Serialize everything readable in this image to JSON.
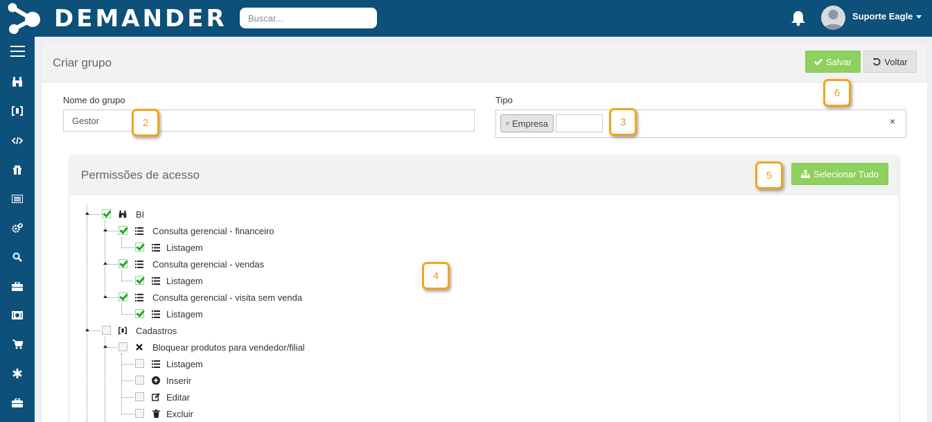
{
  "app": {
    "brand": "DEMANDER",
    "search_placeholder": "Buscar...",
    "user_name": "Suporte Eagle",
    "colors": {
      "topbar": "#0d5079",
      "success": "#8fd05f",
      "callout": "#f5a31a"
    }
  },
  "sidebar": {
    "items": [
      {
        "icon": "menu-icon"
      },
      {
        "icon": "binoculars-icon"
      },
      {
        "icon": "bracket-icon"
      },
      {
        "icon": "code-icon"
      },
      {
        "icon": "gift-icon"
      },
      {
        "icon": "list-card-icon"
      },
      {
        "icon": "gears-icon"
      },
      {
        "icon": "search-icon"
      },
      {
        "icon": "briefcase-icon"
      },
      {
        "icon": "money-icon"
      },
      {
        "icon": "cart-icon"
      },
      {
        "icon": "asterisk-icon"
      },
      {
        "icon": "briefcase-icon"
      }
    ]
  },
  "page": {
    "title": "Criar grupo",
    "save_label": "Salvar",
    "back_label": "Voltar",
    "name_label": "Nome do grupo",
    "name_value": "Gestor",
    "type_label": "Tipo",
    "type_tag": "Empresa",
    "tag_remove": "×",
    "clear": "×"
  },
  "permissions": {
    "title": "Permissões de acesso",
    "select_all_label": "Selecionar Tudo",
    "tree": [
      {
        "label": "BI",
        "icon": "binoculars-icon",
        "checked": true
      },
      {
        "label": "Consulta gerencial - financeiro",
        "icon": "list-icon",
        "checked": true
      },
      {
        "label": "Listagem",
        "icon": "list-icon",
        "checked": true
      },
      {
        "label": "Consulta gerencial - vendas",
        "icon": "list-icon",
        "checked": true
      },
      {
        "label": "Listagem",
        "icon": "list-icon",
        "checked": true
      },
      {
        "label": "Consulta gerencial - visita sem venda",
        "icon": "list-icon",
        "checked": true
      },
      {
        "label": "Listagem",
        "icon": "list-icon",
        "checked": true
      },
      {
        "label": "Cadastros",
        "icon": "bracket-icon",
        "checked": false
      },
      {
        "label": "Bloquear produtos para vendedor/filial",
        "icon": "times-icon",
        "checked": false
      },
      {
        "label": "Listagem",
        "icon": "list-icon",
        "checked": false
      },
      {
        "label": "Inserir",
        "icon": "plus-circle-icon",
        "checked": false
      },
      {
        "label": "Editar",
        "icon": "edit-icon",
        "checked": false
      },
      {
        "label": "Excluir",
        "icon": "trash-icon",
        "checked": false
      }
    ]
  },
  "callouts": [
    "2",
    "3",
    "4",
    "5",
    "6"
  ]
}
